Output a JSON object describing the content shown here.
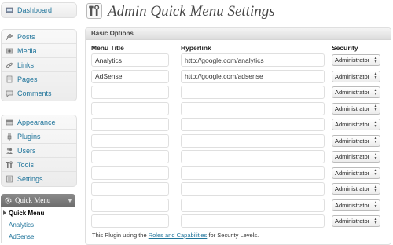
{
  "sidebar": {
    "groups": [
      {
        "items": [
          {
            "label": "Dashboard",
            "icon": "dashboard-icon"
          }
        ]
      },
      {
        "items": [
          {
            "label": "Posts",
            "icon": "pushpin-icon"
          },
          {
            "label": "Media",
            "icon": "media-icon"
          },
          {
            "label": "Links",
            "icon": "link-icon"
          },
          {
            "label": "Pages",
            "icon": "page-icon"
          },
          {
            "label": "Comments",
            "icon": "comment-icon"
          }
        ]
      },
      {
        "items": [
          {
            "label": "Appearance",
            "icon": "appearance-icon"
          },
          {
            "label": "Plugins",
            "icon": "plugin-icon"
          },
          {
            "label": "Users",
            "icon": "users-icon"
          },
          {
            "label": "Tools",
            "icon": "tools-icon"
          },
          {
            "label": "Settings",
            "icon": "settings-icon"
          }
        ]
      }
    ],
    "quick_menu": {
      "title": "Quick Menu",
      "icon": "gear-icon",
      "items": [
        {
          "label": "Quick Menu",
          "current": true
        },
        {
          "label": "Analytics"
        },
        {
          "label": "AdSense"
        }
      ]
    }
  },
  "page": {
    "title": "Admin Quick Menu Settings",
    "icon": "tools-icon"
  },
  "panel": {
    "title": "Basic Options",
    "columns": {
      "menu_title": "Menu Title",
      "hyperlink": "Hyperlink",
      "security": "Security"
    },
    "rows": [
      {
        "title": "Analytics",
        "link": "http://google.com/analytics",
        "security": "Administrator"
      },
      {
        "title": "AdSense",
        "link": "http://google.com/adsense",
        "security": "Administrator"
      },
      {
        "title": "",
        "link": "",
        "security": "Administrator"
      },
      {
        "title": "",
        "link": "",
        "security": "Administrator"
      },
      {
        "title": "",
        "link": "",
        "security": "Administrator"
      },
      {
        "title": "",
        "link": "",
        "security": "Administrator"
      },
      {
        "title": "",
        "link": "",
        "security": "Administrator"
      },
      {
        "title": "",
        "link": "",
        "security": "Administrator"
      },
      {
        "title": "",
        "link": "",
        "security": "Administrator"
      },
      {
        "title": "",
        "link": "",
        "security": "Administrator"
      },
      {
        "title": "",
        "link": "",
        "security": "Administrator"
      }
    ],
    "footnote": {
      "before": "This Plugin using the ",
      "link": "Roles  and  Capabilities",
      "after": " for Security Levels."
    }
  },
  "colors": {
    "link": "#21759b",
    "sidebar_bg": "#f1f1f1",
    "qm_header": "#7a7a7a"
  }
}
